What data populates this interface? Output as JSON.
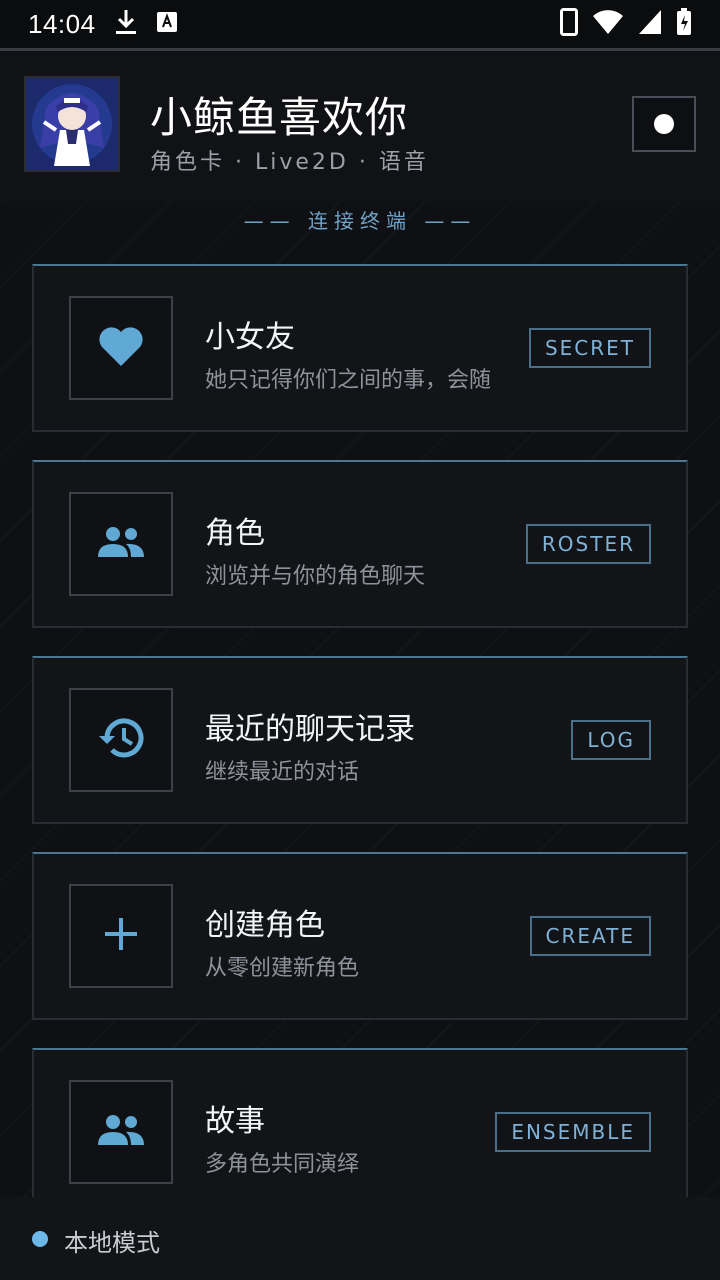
{
  "status_bar": {
    "time": "14:04",
    "icons": [
      "download-icon",
      "text-notification-icon",
      "phone-icon",
      "wifi-icon",
      "signal-icon",
      "battery-charging-icon"
    ]
  },
  "header": {
    "title": "小鲸鱼喜欢你",
    "subtitle": "角色卡 · Live2D · 语音",
    "button_icon": "circle-dot-icon"
  },
  "main": {
    "section_label": "—— 连接终端 ——",
    "cards": [
      {
        "title": "小女友",
        "description": "她只记得你们之间的事，会随",
        "tag": "SECRET",
        "icon": "heart-icon"
      },
      {
        "title": "角色",
        "description": "浏览并与你的角色聊天",
        "tag": "ROSTER",
        "icon": "people-icon"
      },
      {
        "title": "最近的聊天记录",
        "description": "继续最近的对话",
        "tag": "LOG",
        "icon": "history-icon"
      },
      {
        "title": "创建角色",
        "description": "从零创建新角色",
        "tag": "CREATE",
        "icon": "plus-icon"
      },
      {
        "title": "故事",
        "description": "多角色共同演绎",
        "tag": "ENSEMBLE",
        "icon": "people-icon"
      }
    ]
  },
  "footer": {
    "mode_label": "本地模式"
  },
  "colors": {
    "accent": "#6fa3c8",
    "icon": "#5fa9d4",
    "background": "#0f1013"
  }
}
